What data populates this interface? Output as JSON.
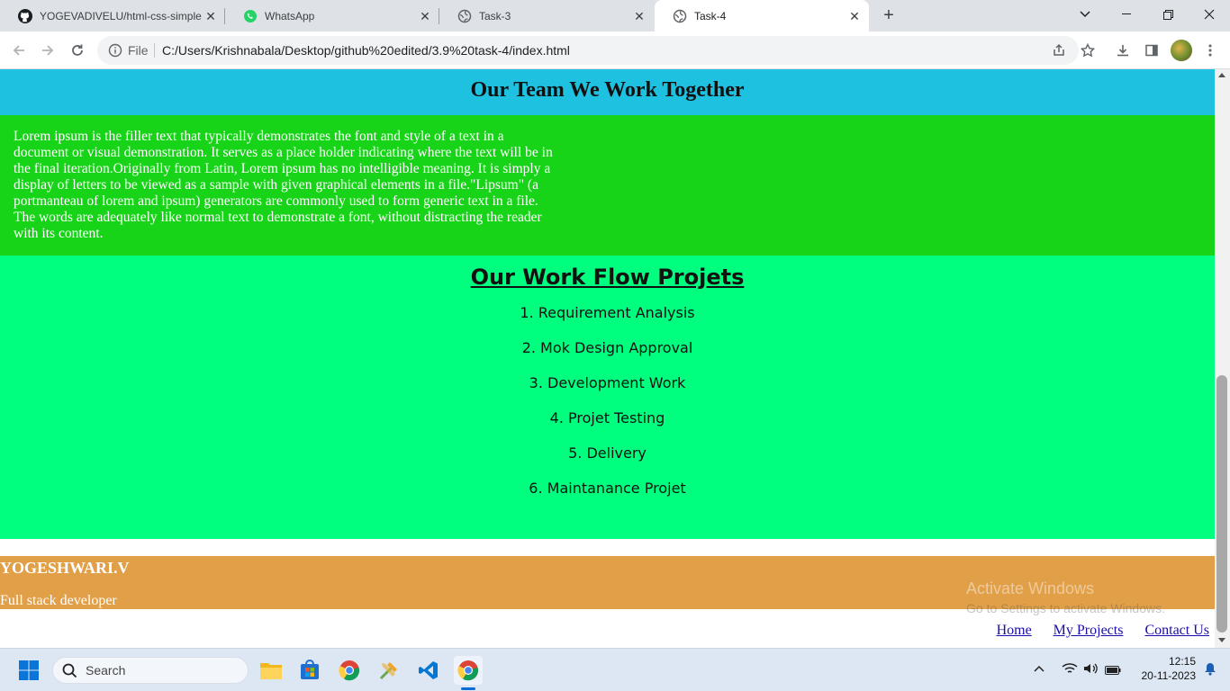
{
  "browser": {
    "tabs": [
      {
        "title": "YOGEVADIVELU/html-css-simple",
        "icon": "github-icon"
      },
      {
        "title": "WhatsApp",
        "icon": "whatsapp-icon"
      },
      {
        "title": "Task-3",
        "icon": "globe-icon"
      },
      {
        "title": "Task-4",
        "icon": "globe-icon",
        "active": true
      }
    ],
    "address": {
      "scheme_label": "File",
      "url": "C:/Users/Krishnabala/Desktop/github%20edited/3.9%20task-4/index.html"
    }
  },
  "page": {
    "team_heading": "Our Team We Work Together",
    "lorem_text": "Lorem ipsum is the filler text that typically demonstrates the font and style of a text in a document or visual demonstration. It serves as a place holder indicating where the text will be in the final iteration.Originally from Latin, Lorem ipsum has no intelligible meaning. It is simply a display of letters to be viewed as a sample with given graphical elements in a file.\"Lipsum\" (a portmanteau of lorem and ipsum) generators are commonly used to form generic text in a file. The words are adequately like normal text to demonstrate a font, without distracting the reader with its content.",
    "workflow_heading": "Our Work Flow Projets",
    "workflow_items": [
      "1. Requirement Analysis",
      "2. Mok Design Approval",
      "3. Development Work",
      "4. Projet Testing",
      "5. Delivery",
      "6. Maintanance Projet"
    ],
    "footer": {
      "name": "YOGESHWARI.V",
      "role": "Full stack developer"
    },
    "nav": [
      "Home",
      "My Projects",
      "Contact Us"
    ],
    "watermark": {
      "line1": "Activate Windows",
      "line2": "Go to Settings to activate Windows."
    },
    "colors": {
      "team_header_bg": "#1ec1e0",
      "lorem_bg": "#18d418",
      "workflow_bg": "#00ff7f",
      "footer_bg": "#e19f48"
    }
  },
  "taskbar": {
    "search_label": "Search",
    "time": "12:15",
    "date": "20-11-2023"
  }
}
